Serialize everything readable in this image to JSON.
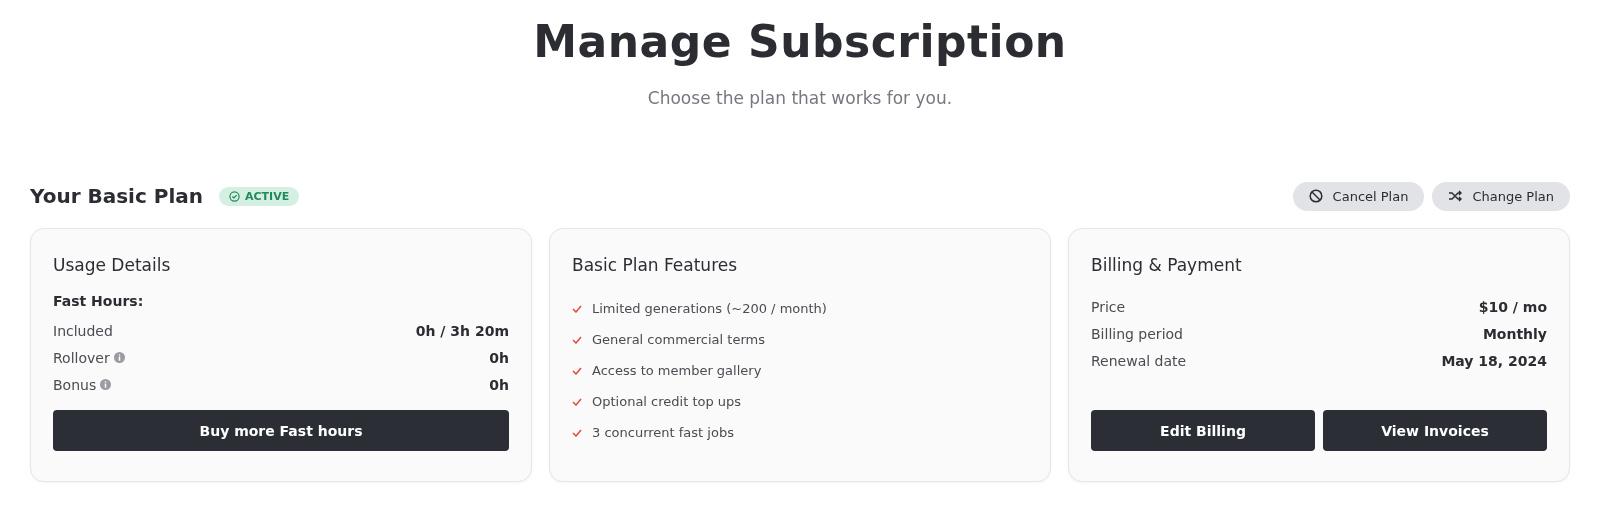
{
  "header": {
    "title": "Manage Subscription",
    "subtitle": "Choose the plan that works for you."
  },
  "plan": {
    "title": "Your Basic Plan",
    "status": {
      "label": "ACTIVE",
      "color": "#1f8a5c"
    },
    "actions": [
      {
        "label": "Cancel Plan",
        "kind": "cancel"
      },
      {
        "label": "Change Plan",
        "kind": "change"
      }
    ]
  },
  "usage": {
    "title": "Usage Details",
    "group": "Fast Hours:",
    "rows": [
      {
        "label": "Included",
        "value": "0h / 3h 20m",
        "info": false
      },
      {
        "label": "Rollover",
        "value": "0h",
        "info": true
      },
      {
        "label": "Bonus",
        "value": "0h",
        "info": true
      }
    ],
    "button": "Buy more Fast hours"
  },
  "features": {
    "title": "Basic Plan Features",
    "items": [
      "Limited generations (~200 / month)",
      "General commercial terms",
      "Access to member gallery",
      "Optional credit top ups",
      "3 concurrent fast jobs"
    ]
  },
  "billing": {
    "title": "Billing & Payment",
    "rows": [
      {
        "label": "Price",
        "value": "$10 / mo"
      },
      {
        "label": "Billing period",
        "value": "Monthly"
      },
      {
        "label": "Renewal date",
        "value": "May 18, 2024"
      }
    ],
    "buttons": [
      "Edit Billing",
      "View Invoices"
    ]
  }
}
